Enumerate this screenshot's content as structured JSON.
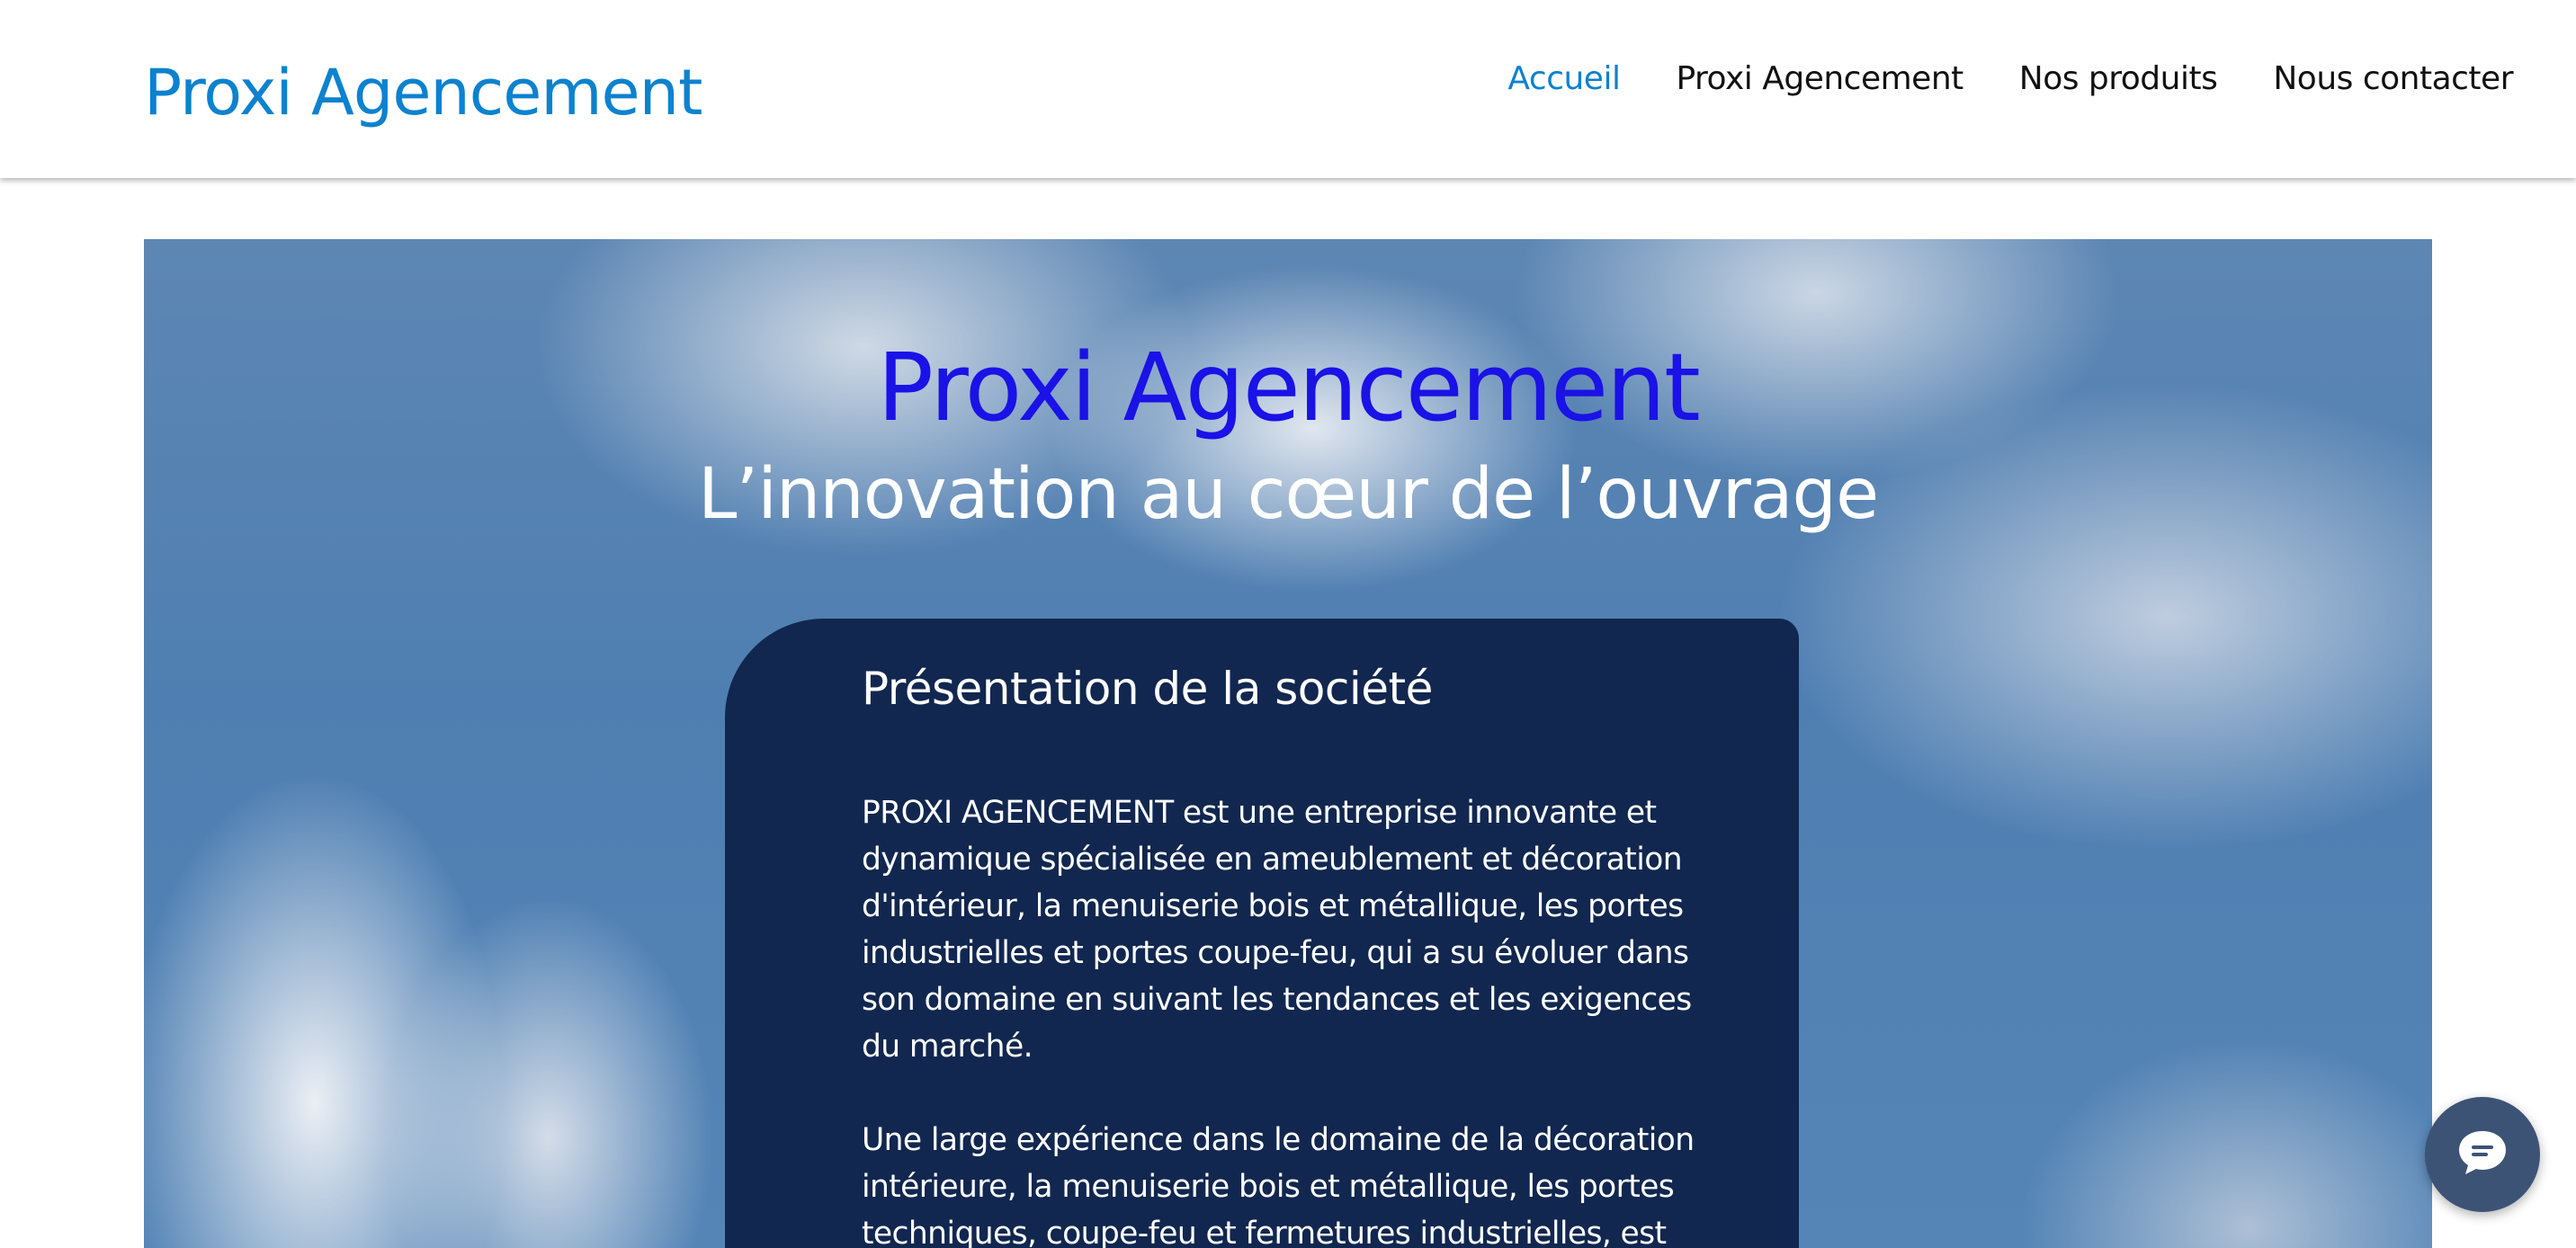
{
  "header": {
    "site_title": "Proxi Agencement",
    "nav": [
      {
        "label": "Accueil",
        "active": true
      },
      {
        "label": "Proxi Agencement",
        "active": false
      },
      {
        "label": "Nos produits",
        "active": false
      },
      {
        "label": "Nous contacter",
        "active": false
      }
    ]
  },
  "hero": {
    "title": "Proxi Agencement",
    "subtitle": "L’innovation au cœur de l’ouvrage"
  },
  "presentation": {
    "heading": "Présentation de la société",
    "paragraphs": [
      "PROXI AGENCEMENT est une entreprise innovante et dynamique spécialisée en ameublement et décoration d'intérieur, la menuiserie bois et métallique, les portes industrielles et portes coupe-feu, qui a su évoluer dans son domaine en suivant les tendances et les exigences du marché.",
      "Une large expérience  dans le domaine de la décoration intérieure, la menuiserie bois et métallique, les portes techniques, coupe-feu et fermetures industrielles, est"
    ]
  },
  "chat": {
    "icon": "chat-bubble-icon"
  },
  "colors": {
    "brand_blue": "#0c82cf",
    "hero_title": "#1a12e6",
    "card_bg": "#11274f",
    "chat_bg": "#3d5375"
  }
}
